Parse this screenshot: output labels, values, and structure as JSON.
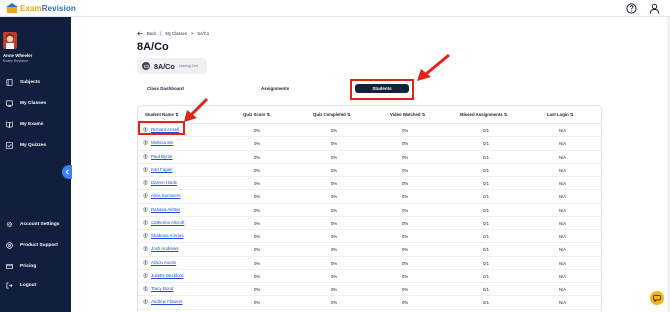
{
  "app": {
    "logo_text_part1": "Exam",
    "logo_text_part2": "Revision",
    "help_icon": "help-circle-icon",
    "account_icon": "user-icon"
  },
  "sidebar": {
    "user_name": "Anne Wheeler",
    "user_sub": "Exam Revision",
    "items": [
      {
        "label": "Subjects",
        "icon": "book-icon"
      },
      {
        "label": "My Classes",
        "icon": "class-icon"
      },
      {
        "label": "My Exams",
        "icon": "exam-icon"
      },
      {
        "label": "My Quizzes",
        "icon": "quiz-icon"
      }
    ],
    "bottom_items": [
      {
        "label": "Account Settings",
        "icon": "gear-icon"
      },
      {
        "label": "Product Support",
        "icon": "support-icon"
      },
      {
        "label": "Pricing",
        "icon": "card-icon"
      },
      {
        "label": "Logout",
        "icon": "logout-icon"
      }
    ]
  },
  "breadcrumb": {
    "back": "Back",
    "sep": "|",
    "my_classes": "My Classes",
    "arrow": ">",
    "current": "8A/Co"
  },
  "page": {
    "title": "8A/Co",
    "chip_title": "8A/Co",
    "chip_sub": "Leaving Cert"
  },
  "tabs": {
    "class_dashboard": "Class Dashboard",
    "assignments": "Assignments",
    "students": "Students"
  },
  "table": {
    "columns": [
      "Student Name ⇅",
      "Quiz Score ⇅",
      "Quiz Completed ⇅",
      "Video Watched ⇅",
      "Missed Assignments ⇅",
      "Last Login ⇅"
    ],
    "rows": [
      {
        "name": "Richard Ansell",
        "quiz_score": "0%",
        "quiz_completed": "0%",
        "video_watched": "0%",
        "missed": "0/1",
        "last_login": "N/A"
      },
      {
        "name": "Melissa Sin",
        "quiz_score": "0%",
        "quiz_completed": "0%",
        "video_watched": "0%",
        "missed": "0/1",
        "last_login": "N/A"
      },
      {
        "name": "Paul Byrne",
        "quiz_score": "0%",
        "quiz_completed": "0%",
        "video_watched": "0%",
        "missed": "0/1",
        "last_login": "N/A"
      },
      {
        "name": "Karl Fagan",
        "quiz_score": "0%",
        "quiz_completed": "0%",
        "video_watched": "0%",
        "missed": "0/1",
        "last_login": "N/A"
      },
      {
        "name": "Darren Hinde",
        "quiz_score": "0%",
        "quiz_completed": "0%",
        "video_watched": "0%",
        "missed": "0/1",
        "last_login": "N/A"
      },
      {
        "name": "Alice Summers",
        "quiz_score": "0%",
        "quiz_completed": "0%",
        "video_watched": "0%",
        "missed": "0/1",
        "last_login": "N/A"
      },
      {
        "name": "Rahana Akhtar",
        "quiz_score": "0%",
        "quiz_completed": "0%",
        "video_watched": "0%",
        "missed": "0/1",
        "last_login": "N/A"
      },
      {
        "name": "Catherine Allcroft",
        "quiz_score": "0%",
        "quiz_completed": "0%",
        "video_watched": "0%",
        "missed": "0/1",
        "last_login": "N/A"
      },
      {
        "name": "Shabana Amrani",
        "quiz_score": "0%",
        "quiz_completed": "0%",
        "video_watched": "0%",
        "missed": "0/1",
        "last_login": "N/A"
      },
      {
        "name": "Josh Andrews",
        "quiz_score": "0%",
        "quiz_completed": "0%",
        "video_watched": "0%",
        "missed": "0/1",
        "last_login": "N/A"
      },
      {
        "name": "Alison Austin",
        "quiz_score": "0%",
        "quiz_completed": "0%",
        "video_watched": "0%",
        "missed": "0/1",
        "last_login": "N/A"
      },
      {
        "name": "Juliette Beckford",
        "quiz_score": "0%",
        "quiz_completed": "0%",
        "video_watched": "0%",
        "missed": "0/1",
        "last_login": "N/A"
      },
      {
        "name": "Tracy Bond",
        "quiz_score": "0%",
        "quiz_completed": "0%",
        "video_watched": "0%",
        "missed": "0/1",
        "last_login": "N/A"
      },
      {
        "name": "Andrew Flowers",
        "quiz_score": "0%",
        "quiz_completed": "0%",
        "video_watched": "0%",
        "missed": "0/1",
        "last_login": "N/A"
      },
      {
        "name": "",
        "quiz_score": "",
        "quiz_completed": "",
        "video_watched": "",
        "missed": "",
        "last_login": ""
      }
    ]
  },
  "colors": {
    "sidebar_bg": "#0f1f3d",
    "accent_blue": "#3b82f6",
    "annotation_red": "#e2231a",
    "active_tab": "#14213d",
    "link": "#1d4ed8",
    "chat": "#f3b51a"
  }
}
